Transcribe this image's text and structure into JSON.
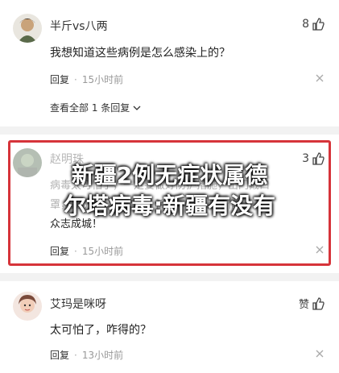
{
  "comments": [
    {
      "username": "半斤vs八两",
      "likes": "8",
      "text": "我想知道这些病例是怎么感染上的？",
      "reply_label": "回复",
      "time": "15小时前",
      "expand_label": "查看全部 1 条回复"
    },
    {
      "username": "赵明珠",
      "likes": "3",
      "text_line1": "病毒太可怕了，一定要做好防护措施，出门戴口",
      "text_line2": "罩，勤洗手，少聚集，希望早日战胜疫情，",
      "text_line3": "众志成城！",
      "reply_label": "回复",
      "time": "15小时前"
    },
    {
      "username": "艾玛是咪呀",
      "likes": "赞",
      "text": "太可怕了，咋得的？",
      "reply_label": "回复",
      "time": "13小时前"
    }
  ],
  "overlay": {
    "line1": "新疆2例无症状属德",
    "line2": "尔塔病毒:新疆有没有"
  },
  "colors": {
    "frame": "#d6343a",
    "overlay_text": "#ffffff",
    "muted": "#999999"
  },
  "icons": [
    "thumb-up-icon",
    "close-icon",
    "chevron-down-icon"
  ]
}
